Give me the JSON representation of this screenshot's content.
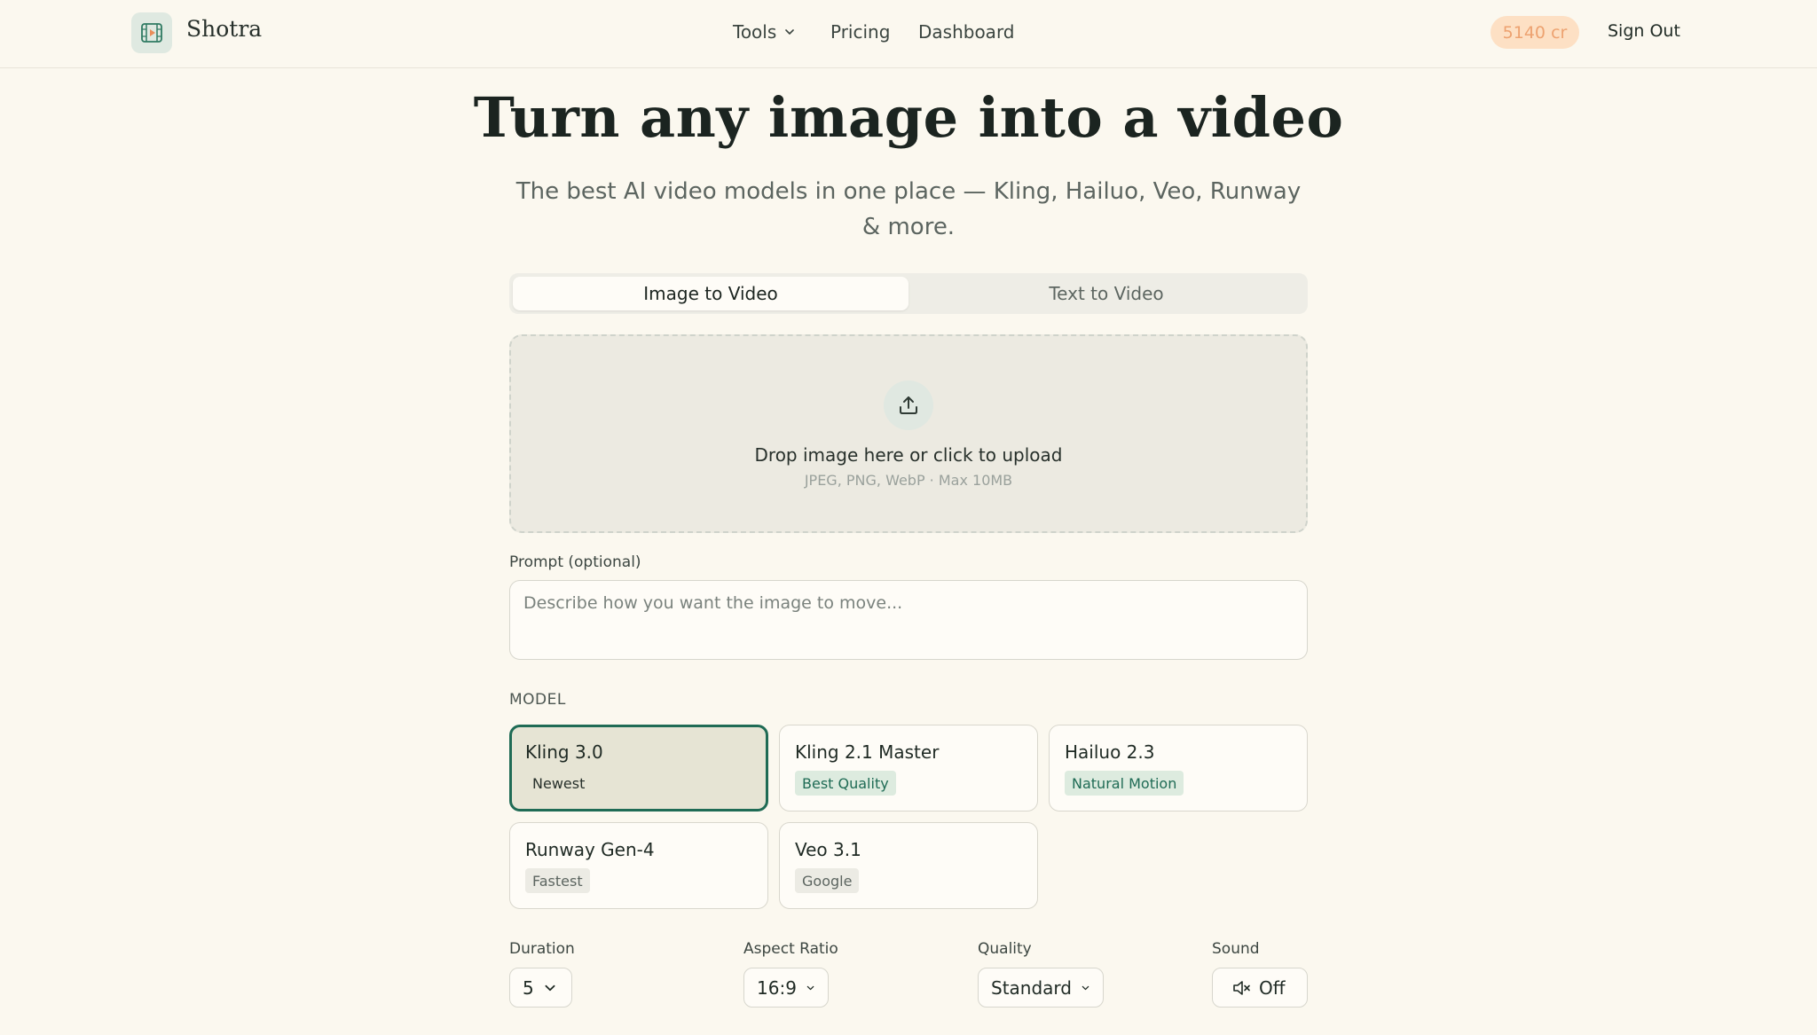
{
  "header": {
    "brand": "Shotra",
    "nav": [
      {
        "label": "Tools"
      },
      {
        "label": "Pricing"
      },
      {
        "label": "Dashboard"
      }
    ],
    "credits": "5140 cr",
    "sign_out": "Sign Out"
  },
  "hero": {
    "title": "Turn any image into a video",
    "subtitle": "The best AI video models in one place — Kling, Hailuo, Veo, Runway & more."
  },
  "tabs": [
    {
      "label": "Image to Video",
      "active": true
    },
    {
      "label": "Text to Video",
      "active": false
    }
  ],
  "upload": {
    "title": "Drop image here or click to upload",
    "hint": "JPEG, PNG, WebP · Max 10MB"
  },
  "prompt": {
    "label": "Prompt (optional)",
    "placeholder": "Describe how you want the image to move..."
  },
  "models": {
    "label": "MODEL",
    "items": [
      {
        "name": "Kling 3.0",
        "badge": "Newest",
        "selected": true
      },
      {
        "name": "Kling 2.1 Master",
        "badge": "Best Quality"
      },
      {
        "name": "Hailuo 2.3",
        "badge": "Natural Motion"
      },
      {
        "name": "Runway Gen-4",
        "badge": "Fastest"
      },
      {
        "name": "Veo 3.1",
        "badge": "Google"
      }
    ]
  },
  "settings": {
    "duration": {
      "label": "Duration",
      "value": "5"
    },
    "aspect": {
      "label": "Aspect Ratio",
      "value": "16:9"
    },
    "quality": {
      "label": "Quality",
      "value": "Standard"
    },
    "sound": {
      "label": "Sound",
      "value": "Off"
    }
  },
  "colors": {
    "accent": "#1f6b55",
    "background": "#fbf8ef",
    "credits_bg": "#fde0c4"
  }
}
